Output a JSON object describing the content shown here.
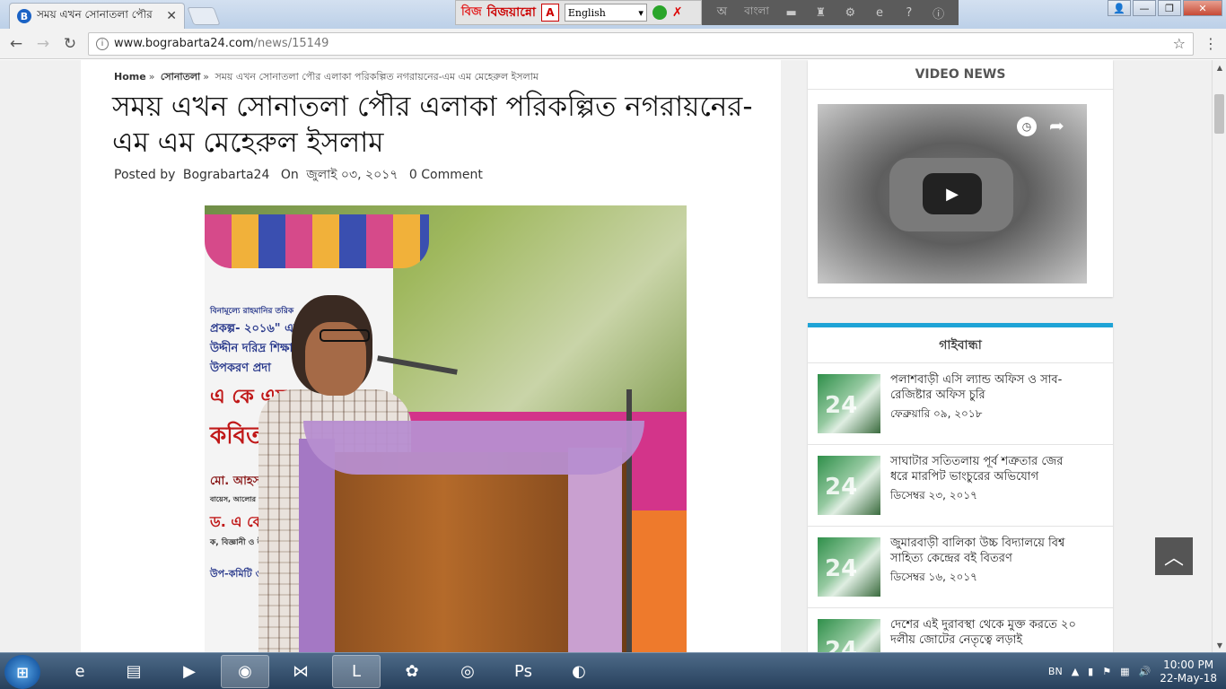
{
  "browser": {
    "tab_title": "সময় এখন সোনাতলা পৌর",
    "favicon_letter": "B",
    "url_host": "www.bograbarta24.com",
    "url_path": "/news/15149"
  },
  "extension": {
    "logo": "বিজ",
    "name": "বিজয়ান্নো",
    "box": "A",
    "language": "English",
    "dark_label": "বাংলা",
    "dark_glyph": "অ"
  },
  "page": {
    "breadcrumb": {
      "home": "Home",
      "category": "সোনাতলা",
      "current": "সময় এখন সোনাতলা পৌর এলাকা পরিকল্পিত নগরায়নের-এম এম মেহেরুল ইসলাম",
      "separator": "»"
    },
    "headline": "সময় এখন সোনাতলা পৌর এলাকা পরিকল্পিত নগরায়নের-এম এম মেহেরুল ইসলাম",
    "meta": {
      "posted_by_label": "Posted by",
      "author": "Bograbarta24",
      "on_label": "On",
      "date": "জুলাই ০৩, ২০১৭",
      "comments": "0 Comment"
    },
    "photo_banner_lines": [
      "বিনামূল্যে রাহমানির তরিক",
      "প্রকল্প- ২০১৬\" এর ক",
      "উদ্দীন দরিদ্র শিক্ষা",
      "উপকরণ প্রদা",
      "এ কে এম আ",
      "কবিতা",
      "মো. আহসান",
      "বায়েস, আলোর প্রদীপ ও ড",
      "ড. এ কে এম আ",
      "ক, বিজ্ঞানী ও উপ-পরিচাল",
      "উপ-কমিটি ও সাং"
    ]
  },
  "sidebar": {
    "video_title": "VIDEO NEWS",
    "district_title": "গাইবান্ধা",
    "thumb_watermark": "24",
    "news": [
      {
        "headline": "পলাশবাড়ী এসি ল্যান্ড অফিস ও সাব-রেজিষ্টার অফিস চুরি",
        "date": "ফেব্রুয়ারি ০৯, ২০১৮"
      },
      {
        "headline": "সাঘাটার সতিতলায় পূর্ব শত্রুতার জের ধরে মারপিট ভাংচুরের অভিযোগ",
        "date": "ডিসেম্বর ২৩, ২০১৭"
      },
      {
        "headline": "জুমারবাড়ী বালিকা উচ্চ বিদ্যালয়ে বিশ্ব সাহিত্য কেন্দ্রের বই বিতরণ",
        "date": "ডিসেম্বর ১৬, ২০১৭"
      },
      {
        "headline": "দেশের এই দুরাবস্থা থেকে মুক্ত করতে ২০ দলীয় জোটের নেতৃত্বে লড়াই",
        "date": ""
      }
    ]
  },
  "taskbar": {
    "language": "BN",
    "time": "10:00 PM",
    "date": "22-May-18"
  },
  "colors": {
    "accent_blue": "#1ea3d6",
    "brand_blue": "#1b63c5"
  }
}
